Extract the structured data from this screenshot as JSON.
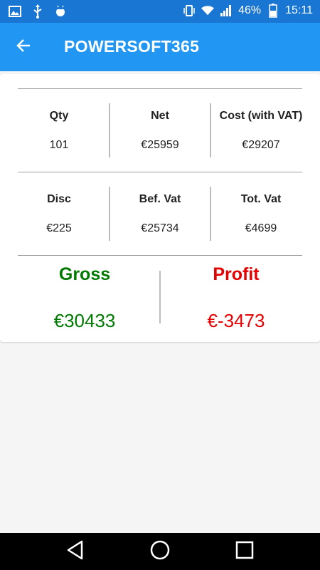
{
  "status_bar": {
    "battery_percent": "46%",
    "time": "15:11",
    "left_icons": [
      "image-icon",
      "usb-icon",
      "android-debug-icon"
    ],
    "right_icons": [
      "vibrate-icon",
      "wifi-icon",
      "signal-icon",
      "battery-icon"
    ]
  },
  "app_bar": {
    "title": "POWERSOFT365",
    "back_icon": "arrow-back-icon"
  },
  "summary": {
    "row1": [
      {
        "label": "Qty",
        "value": "101"
      },
      {
        "label": "Net",
        "value": "€25959"
      },
      {
        "label": "Cost (with VAT)",
        "value": "€29207"
      }
    ],
    "row2": [
      {
        "label": "Disc",
        "value": "€225"
      },
      {
        "label": "Bef. Vat",
        "value": "€25734"
      },
      {
        "label": "Tot. Vat",
        "value": "€4699"
      }
    ],
    "gross": {
      "label": "Gross",
      "value": "€30433",
      "color": "#007a00"
    },
    "profit": {
      "label": "Profit",
      "value": "€-3473",
      "color": "#e60000"
    }
  },
  "nav_bar": {
    "buttons": [
      "back-triangle-icon",
      "home-circle-icon",
      "recents-square-icon"
    ]
  },
  "colors": {
    "status_bar": "#1976d2",
    "app_bar": "#2196f3"
  }
}
